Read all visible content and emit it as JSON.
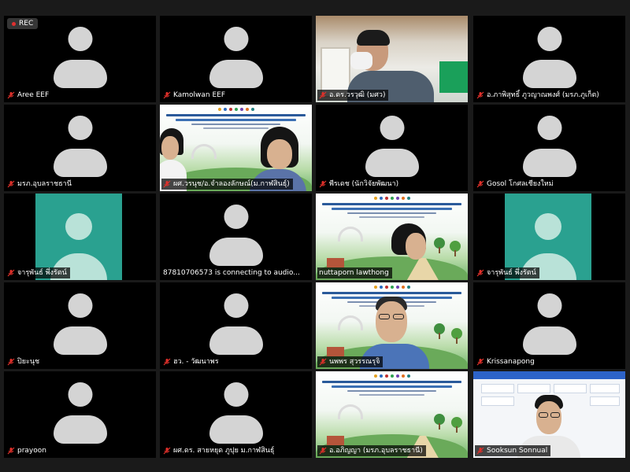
{
  "recording": {
    "label": "REC"
  },
  "participants": [
    {
      "name": "Aree EEF"
    },
    {
      "name": "Kamolwan EEF"
    },
    {
      "name": "อ.ดร.วรวุฒิ (มศว)"
    },
    {
      "name": "อ.ภาพิสุทธิ์ ภูวญาณพงศ์ (มรภ.ภูเก็ต)"
    },
    {
      "name": "มรภ.อุบลราชธานี"
    },
    {
      "name": "ผศ.วรนุช/อ.จำลองลักษณ์(ม.กาฬสินธุ์)"
    },
    {
      "name": "พีรเดช (นักวิจัยพัฒนา)"
    },
    {
      "name": "Gosol โกศลเชียงใหม่"
    },
    {
      "name": "จารุพันธ์ พึ่งรัตน์"
    },
    {
      "name": "87810706573 is connecting to audio..."
    },
    {
      "name": "nuttaporn lawthong"
    },
    {
      "name": "จารุพันธ์ พึ่งรัตน์"
    },
    {
      "name": "ปิยะนุช"
    },
    {
      "name": "ฮว. - วัฒนาพร"
    },
    {
      "name": "นพพร สุวรรณรุจิ"
    },
    {
      "name": "Krissanapong"
    },
    {
      "name": "prayoon"
    },
    {
      "name": "ผศ.ดร. สายหยุด ภูปุย ม.กาฬสินธุ์"
    },
    {
      "name": "อ.อภิญญา (มรภ.อุบลราชธานี)"
    },
    {
      "name": "Sooksun Sonnual"
    }
  ],
  "colors": {
    "muted_mic": "#e0302a",
    "teal": "#2aa190",
    "active_border": "#e6e600"
  }
}
